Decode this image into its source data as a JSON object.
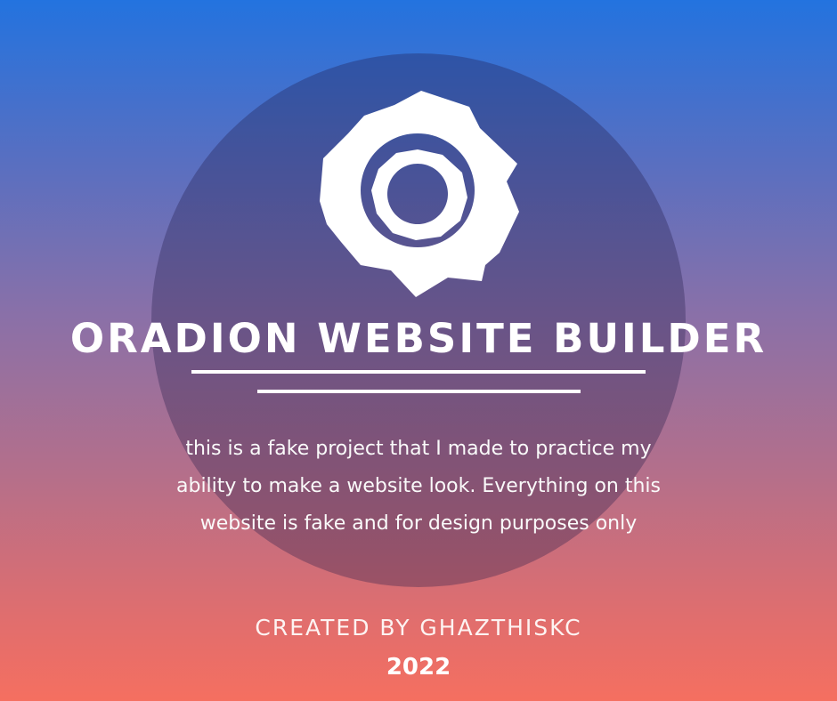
{
  "title": "ORADION WEBSITE BUILDER",
  "description": "this is a fake project that I made to practice my ability to make a website look. Everything on this website is fake and for design purposes only",
  "credit": "CREATED BY GHAZTHISKC",
  "year": "2022",
  "logo_icon": "gear-icon",
  "colors": {
    "gradient_top": "#2373df",
    "gradient_bottom": "#f56f60",
    "text": "#ffffff"
  }
}
